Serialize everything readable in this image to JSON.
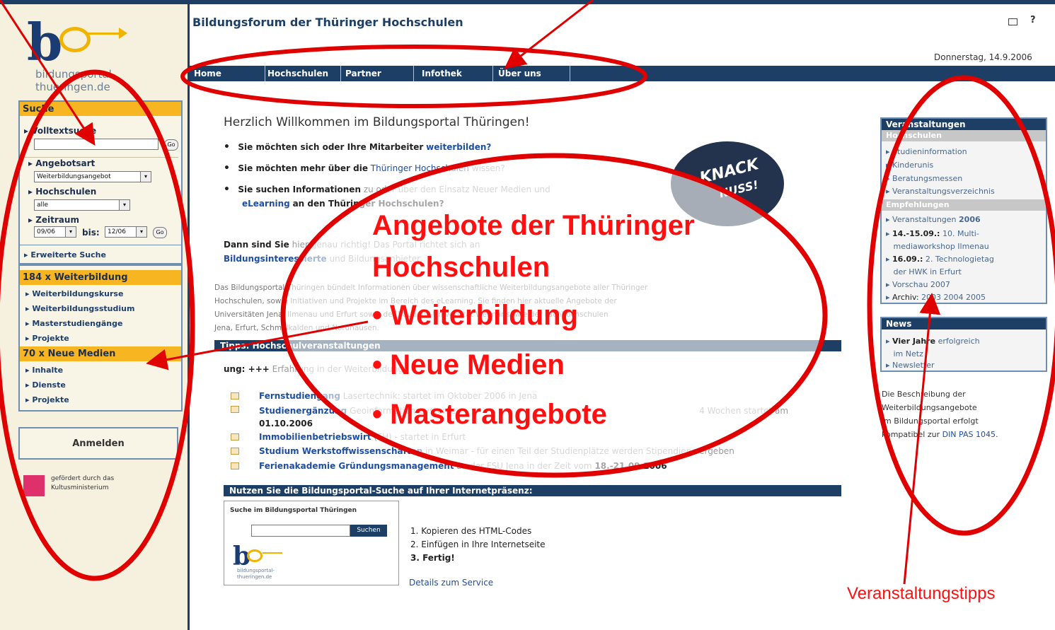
{
  "header": {
    "title": "Bildungsforum der Thüringer Hochschulen",
    "date": "Donnerstag, 14.9.2006",
    "icons": [
      "mail-icon",
      "help-icon"
    ],
    "help_glyph": "?"
  },
  "logo": {
    "text_line1": "bildungsportal-",
    "text_line2": "thueringen.de"
  },
  "nav": {
    "items": [
      "Home",
      "Hochschulen",
      "Partner",
      "Infothek",
      "Über uns"
    ]
  },
  "sidebar": {
    "search_title": "Suche",
    "fulltext_label": "Volltextsuche",
    "offer_label": "Angebotsart",
    "offer_value": "Weiterbildungsangebot",
    "universities_label": "Hochschulen",
    "universities_value": "alle",
    "period_label": "Zeitraum",
    "period_from": "09/06",
    "period_to_label": "bis:",
    "period_to": "12/06",
    "go_label": "Go",
    "extended_search": "Erweiterte Suche",
    "section1_title": "184 x Weiterbildung",
    "section1_items": [
      "Weiterbildungskurse",
      "Weiterbildungsstudium",
      "Masterstudiengänge",
      "Projekte"
    ],
    "section2_title": "70 x Neue Medien",
    "section2_items": [
      "Inhalte",
      "Dienste",
      "Projekte"
    ],
    "login": "Anmelden",
    "sponsor_line1": "gefördert durch das",
    "sponsor_line2": "Kultusministerium"
  },
  "main": {
    "welcome": "Herzlich Willkommen im Bildungsportal Thüringen!",
    "q1_text": "Sie möchten sich oder Ihre Mitarbeiter",
    "q1_link": "weiterbilden?",
    "q2_text": "Sie möchten mehr über die",
    "q2_link": "Thüringer Hochschulen",
    "q2_end": "wissen?",
    "q3_text": "Sie suchen Informationen",
    "q3_grey": "zu oder über den Einsatz Neuer Medien und",
    "q3_link": "eLearning",
    "q3_end": "an den Thüringer Hochschulen?",
    "badge_text1": "KNACK",
    "badge_text2": "NUSS!",
    "intro_start": "Dann sind Sie",
    "intro_grey": "hier genau richtig! Das Portal richtet sich an",
    "intro_line2_bold": "Bildungsinteressierte",
    "intro_line2_grey": "und Bildungsanbieter.",
    "para": [
      "Das Bildungsportal Thüringen bündelt Informationen über wissenschaftliche Weiterbildungsangebote aller Thüringer",
      "Hochschulen, sowie Initiativen und Projekte im Bereich des eLearning. Sie finden hier aktuelle Angebote der",
      "Universitäten Jena, Ilmenau und Erfurt sowie der Bauhaus-Universität Weimar sowie der Fachhochschulen",
      "Jena, Erfurt, Schmalkalden und Nordhausen."
    ],
    "tips_bar": "Tipps: Hochschulveranstaltungen",
    "ticker_start": "ung: +++",
    "ticker_rest": "Erfahrung in der Weiterbildung",
    "tips": [
      {
        "bold": "Fernstudiengang",
        "grey": "Lasertechnik: startet im Oktober 2006 in Jena",
        "tail": ""
      },
      {
        "bold": "Studienergänzung",
        "grey": "Geoinformationssysteme",
        "tail": ""
      },
      {
        "bold": "Immobilienbetriebswirt",
        "grey": "(FH) - startet in Erfurt",
        "tail": ""
      },
      {
        "bold": "Studium Werkstoffwissenschaften",
        "grey": "in Weimar - für einen Teil der Studienplätze werden Stipendien vergeben",
        "tail": ""
      },
      {
        "bold": "Ferienakademie Gründungsmanagement",
        "grey": "an der FSU Jena in der Zeit vom",
        "tail": "18.-21.09.2006"
      }
    ],
    "tip2_line2": "01.10.2006",
    "tip2_right": "4 Wochen startet am",
    "use_search_bar": "Nutzen Sie die Bildungsportal-Suche auf Ihrer Internetpräsenz:",
    "widget_title": "Suche im Bildungsportal Thüringen",
    "widget_button": "Suchen",
    "widget_logo_line1": "bildungsportal-",
    "widget_logo_line2": "thueringen.de",
    "steps": [
      "1. Kopieren des HTML-Codes",
      "2. Einfügen in Ihre Internetseite",
      "3. Fertig!"
    ],
    "details_link": "Details zum Service"
  },
  "right": {
    "events_title": "Veranstaltungen",
    "sub1": "Hochschulen",
    "list1": [
      "Studieninformation",
      "Kinderunis",
      "Beratungsmessen",
      "Veranstaltungsverzeichnis"
    ],
    "sub2": "Empfehlungen",
    "ev1_text": "Veranstaltungen",
    "ev1_year": "2006",
    "ev2_date": "14.-15.09.:",
    "ev2_l1": "10. Multi-",
    "ev2_l2": "mediaworkshop Ilmenau",
    "ev3_date": "16.09.:",
    "ev3_l1": "2. Technologietag",
    "ev3_l2": "der HWK in Erfurt",
    "ev4": "Vorschau 2007",
    "archive_label": "Archiv:",
    "archive_years": "2003 2004 2005",
    "news_title": "News",
    "news1_bold": "Vier Jahre",
    "news1_rest": "erfolgreich",
    "news1_l2": "im Netz",
    "news2": "Newsletter",
    "note": [
      "Die Beschreibung der",
      "Weiterbildungsangebote",
      "im Bildungsportal erfolgt",
      "kompatibel zur"
    ],
    "note_link": "DIN PAS 1045."
  },
  "annotations": {
    "center_title_l1": "Angebote der Thüringer",
    "center_title_l2": "Hochschulen",
    "center_items": [
      "• Weiterbildung",
      "• Neue Medien",
      "• Masterangebote"
    ],
    "right_label": "Veranstaltungstipps",
    "color": "#ff0000"
  }
}
